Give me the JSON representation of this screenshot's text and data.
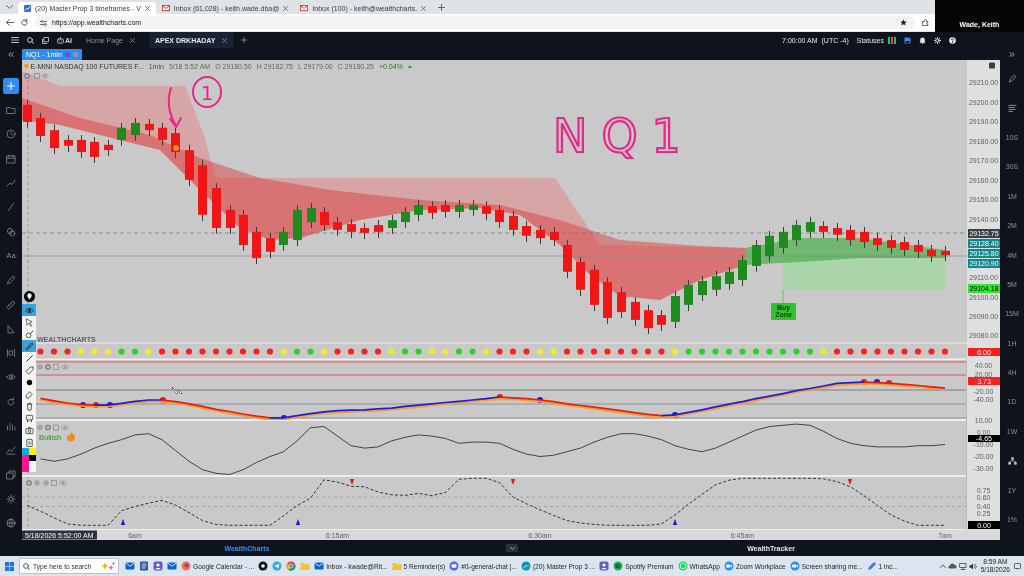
{
  "browser": {
    "tabs": [
      {
        "title": "(20) Master Prop 3 timeframes - V",
        "selected": true
      },
      {
        "title": "Inbox (61,028) - keith.wade.dba@",
        "selected": false
      },
      {
        "title": "Inbox (100) - keith@wealthcharts.",
        "selected": false
      }
    ],
    "url": "https://app.wealthcharts.com"
  },
  "video_tile": {
    "name": "Wade, Keith"
  },
  "app_header": {
    "ai_label": "AI",
    "tabs": [
      {
        "label": "Home Page",
        "selected": false
      },
      {
        "label": "APEX DRKHADAY",
        "selected": true
      }
    ],
    "clock": "7:00:00 AM",
    "timezone": "(UTC -4)",
    "statuses_label": "Statuses",
    "status_bars": [
      {
        "color": "#22c55e"
      },
      {
        "color": "#ef4444"
      },
      {
        "color": "#22c55e"
      }
    ]
  },
  "layout_tab": {
    "label": "NQ1 - 1min"
  },
  "left_toolbar": {
    "text_tool": "Aa"
  },
  "chart": {
    "symbol": "E-MINI NASDAQ 100 FUTURES F...",
    "interval": "1min",
    "bar_time": "5/18 5:52 AM",
    "ohlc": [
      "O 29180.50",
      "H 29182.75",
      "L 29179.00",
      "C 29180.25"
    ],
    "change": "+0.04%",
    "chart_data": {
      "type": "candlestick",
      "x": [
        5.8667,
        5.8833,
        5.9,
        5.9167,
        5.9333,
        5.95,
        5.9667,
        5.9833,
        6,
        6.0167,
        6.0333,
        6.05,
        6.0667,
        6.0833,
        6.1,
        6.1167,
        6.1333,
        6.15,
        6.1667,
        6.1833,
        6.2,
        6.2167,
        6.2333,
        6.25,
        6.2667,
        6.2833,
        6.3,
        6.3167,
        6.3333,
        6.35,
        6.3667,
        6.3833,
        6.4,
        6.4167,
        6.4333,
        6.45,
        6.4667,
        6.4833,
        6.5,
        6.5167,
        6.5333,
        6.55,
        6.5667,
        6.5833,
        6.6,
        6.6167,
        6.6333,
        6.65,
        6.6667,
        6.6833,
        6.7,
        6.7167,
        6.7333,
        6.75,
        6.7667,
        6.7833,
        6.8,
        6.8167,
        6.8333,
        6.85,
        6.8667,
        6.8833,
        6.9,
        6.9167,
        6.9333,
        6.95,
        6.9667,
        6.9833,
        7
      ],
      "ohlc": [
        [
          29198.75,
          29201.25,
          29187.0,
          29190.0
        ],
        [
          29192.0,
          29194.5,
          29179.75,
          29182.75
        ],
        [
          29185.75,
          29188.5,
          29173.5,
          29176.5
        ],
        [
          29180.75,
          29183.25,
          29174.5,
          29177.75
        ],
        [
          29180.75,
          29183.25,
          29171.5,
          29174.5
        ],
        [
          29179.75,
          29182.25,
          29169.0,
          29172.0
        ],
        [
          29178.25,
          29180.75,
          29172.5,
          29175.5
        ],
        [
          29180.75,
          29189.5,
          29177.75,
          29187.0
        ],
        [
          29183.25,
          29192.0,
          29180.25,
          29189.5
        ],
        [
          29189.0,
          29191.5,
          29182.75,
          29185.75
        ],
        [
          29187.0,
          29189.5,
          29177.75,
          29180.75
        ],
        [
          29184.25,
          29187.0,
          29171.5,
          29174.5
        ],
        [
          29175.5,
          29178.25,
          29157.0,
          29160.25
        ],
        [
          29167.75,
          29170.5,
          29139.0,
          29142.25
        ],
        [
          29156.0,
          29158.5,
          29132.5,
          29135.5
        ],
        [
          29144.75,
          29147.25,
          29132.5,
          29135.5
        ],
        [
          29142.25,
          29144.75,
          29123.75,
          29126.75
        ],
        [
          29133.5,
          29136.0,
          29117.0,
          29120.0
        ],
        [
          29130.25,
          29133.0,
          29120.0,
          29123.25
        ],
        [
          29126.75,
          29136.0,
          29123.75,
          29133.5
        ],
        [
          29129.25,
          29147.25,
          29126.25,
          29144.75
        ],
        [
          29138.5,
          29148.25,
          29135.5,
          29145.75
        ],
        [
          29143.75,
          29146.25,
          29134.0,
          29137.0
        ],
        [
          29138.5,
          29141.25,
          29131.5,
          29134.5
        ],
        [
          29137.5,
          29140.0,
          29130.25,
          29133.5
        ],
        [
          29135.5,
          29138.0,
          29129.75,
          29133.0
        ],
        [
          29137.0,
          29139.5,
          29130.25,
          29133.5
        ],
        [
          29135.5,
          29142.25,
          29132.5,
          29139.5
        ],
        [
          29138.5,
          29146.25,
          29135.5,
          29143.75
        ],
        [
          29142.25,
          29150.0,
          29139.0,
          29147.25
        ],
        [
          29146.75,
          29149.25,
          29140.0,
          29143.25
        ],
        [
          29147.25,
          29150.0,
          29140.75,
          29143.75
        ],
        [
          29143.75,
          29150.0,
          29140.75,
          29147.25
        ],
        [
          29144.75,
          29150.0,
          29141.75,
          29147.25
        ],
        [
          29146.75,
          29149.25,
          29139.5,
          29142.75
        ],
        [
          29144.75,
          29147.25,
          29135.5,
          29138.5
        ],
        [
          29141.75,
          29144.25,
          29131.5,
          29134.5
        ],
        [
          29136.5,
          29139.0,
          29128.25,
          29131.5
        ],
        [
          29134.5,
          29137.0,
          29127.25,
          29130.25
        ],
        [
          29133.5,
          29136.0,
          29126.25,
          29129.25
        ],
        [
          29126.75,
          29129.25,
          29109.75,
          29113.0
        ],
        [
          29118.0,
          29120.5,
          29100.5,
          29103.75
        ],
        [
          29114.0,
          29116.5,
          29092.75,
          29096.0
        ],
        [
          29107.75,
          29110.25,
          29086.25,
          29089.25
        ],
        [
          29102.5,
          29105.25,
          29089.25,
          29092.25
        ],
        [
          29097.5,
          29100.0,
          29085.25,
          29088.25
        ],
        [
          29093.25,
          29096.0,
          29081.0,
          29084.0
        ],
        [
          29090.75,
          29093.25,
          29082.5,
          29085.75
        ],
        [
          29087.25,
          29103.0,
          29084.0,
          29100.5
        ],
        [
          29096.0,
          29108.75,
          29092.75,
          29106.25
        ],
        [
          29101.0,
          29110.75,
          29098.0,
          29108.25
        ],
        [
          29103.75,
          29113.5,
          29100.5,
          29110.75
        ],
        [
          29106.75,
          29115.5,
          29103.75,
          29113.0
        ],
        [
          29108.75,
          29121.5,
          29105.75,
          29119.0
        ],
        [
          29116.0,
          29129.25,
          29113.0,
          29126.75
        ],
        [
          29121.0,
          29134.0,
          29118.0,
          29131.5
        ],
        [
          29125.25,
          29136.0,
          29122.25,
          29133.5
        ],
        [
          29129.25,
          29139.5,
          29126.25,
          29137.0
        ],
        [
          29133.5,
          29141.25,
          29130.25,
          29138.5
        ],
        [
          29136.5,
          29139.0,
          29130.25,
          29133.5
        ],
        [
          29135.5,
          29138.0,
          29128.75,
          29132.0
        ],
        [
          29134.5,
          29137.0,
          29126.25,
          29129.25
        ],
        [
          29133.5,
          29136.0,
          29125.25,
          29128.25
        ],
        [
          29130.25,
          29133.0,
          29123.75,
          29126.75
        ],
        [
          29129.25,
          29132.0,
          29122.25,
          29125.25
        ],
        [
          29128.25,
          29131.0,
          29121.0,
          29124.25
        ],
        [
          29126.75,
          29129.25,
          29120.0,
          29123.25
        ],
        [
          29124.25,
          29126.75,
          29118.0,
          29121.0
        ],
        [
          29123.75,
          29126.25,
          29118.5,
          29121.5
        ]
      ],
      "xlim": [
        5.8605,
        7.0272
      ],
      "ylim": [
        28980.3,
        29221.8
      ],
      "yticks": [
        {
          "value": 29210,
          "label": "29210.00"
        },
        {
          "value": 29200,
          "label": "29200.00"
        },
        {
          "value": 29190,
          "label": "29190.00"
        },
        {
          "value": 29180,
          "label": "29180.00"
        },
        {
          "value": 29170,
          "label": "29170.00"
        },
        {
          "value": 29160,
          "label": "29160.00"
        },
        {
          "value": 29150,
          "label": "29150.00"
        },
        {
          "value": 29140,
          "label": "29140.00"
        },
        {
          "value": 29110,
          "label": "29110.00"
        },
        {
          "value": 29100,
          "label": "29100.00"
        },
        {
          "value": 29090,
          "label": "29090.00"
        },
        {
          "value": 29080,
          "label": "29080.00"
        }
      ],
      "xticks": [
        {
          "value": 6,
          "label": "6am"
        },
        {
          "value": 6.25,
          "label": "6:15am"
        },
        {
          "value": 6.5,
          "label": "6:30am"
        },
        {
          "value": 6.75,
          "label": "6:45am"
        },
        {
          "value": 7,
          "label": "7am"
        }
      ]
    },
    "price_tags": [
      {
        "label": "29132.75",
        "color": "#3c4048"
      },
      {
        "label": "29128.40",
        "color": "#13878c"
      },
      {
        "label": "29125.80",
        "color": "#13878c"
      },
      {
        "label": "29120.90",
        "color": "#13878c"
      },
      {
        "label": "29104.18",
        "color": "#2ee82e"
      }
    ],
    "buy_zone": "Buy Zone",
    "annotations": [
      {
        "kind": "circled_number",
        "text": "1"
      },
      {
        "kind": "handwriting",
        "text": "NQ1"
      }
    ]
  },
  "indicators": [
    {
      "kind": "dots",
      "watermark": "WEALTHCHARTS",
      "dots": [
        {
          "color": "#ff1f1f"
        },
        {
          "color": "#ff1f1f"
        },
        {
          "color": "#ff1f1f"
        },
        {
          "color": "#f2ee1a"
        },
        {
          "color": "#f2ee1a"
        },
        {
          "color": "#f2ee1a"
        },
        {
          "color": "#1fd81f"
        },
        {
          "color": "#1fd81f"
        },
        {
          "color": "#f2ee1a"
        },
        {
          "color": "#ff1f1f"
        },
        {
          "color": "#ff1f1f"
        },
        {
          "color": "#ff1f1f"
        },
        {
          "color": "#ff1f1f"
        },
        {
          "color": "#ff1f1f"
        },
        {
          "color": "#ff1f1f"
        },
        {
          "color": "#ff1f1f"
        },
        {
          "color": "#ff1f1f"
        },
        {
          "color": "#ff1f1f"
        },
        {
          "color": "#f2ee1a"
        },
        {
          "color": "#1fd81f"
        },
        {
          "color": "#1fd81f"
        },
        {
          "color": "#f2ee1a"
        },
        {
          "color": "#ff1f1f"
        },
        {
          "color": "#ff1f1f"
        },
        {
          "color": "#ff1f1f"
        },
        {
          "color": "#ff1f1f"
        },
        {
          "color": "#f2ee1a"
        },
        {
          "color": "#1fd81f"
        },
        {
          "color": "#1fd81f"
        },
        {
          "color": "#f2ee1a"
        },
        {
          "color": "#f2ee1a"
        },
        {
          "color": "#1fd81f"
        },
        {
          "color": "#1fd81f"
        },
        {
          "color": "#f2ee1a"
        },
        {
          "color": "#ff1f1f"
        },
        {
          "color": "#ff1f1f"
        },
        {
          "color": "#ff1f1f"
        },
        {
          "color": "#f2ee1a"
        },
        {
          "color": "#f2ee1a"
        },
        {
          "color": "#ff1f1f"
        },
        {
          "color": "#ff1f1f"
        },
        {
          "color": "#ff1f1f"
        },
        {
          "color": "#ff1f1f"
        },
        {
          "color": "#ff1f1f"
        },
        {
          "color": "#ff1f1f"
        },
        {
          "color": "#ff1f1f"
        },
        {
          "color": "#ff1f1f"
        },
        {
          "color": "#f2ee1a"
        },
        {
          "color": "#1fd81f"
        },
        {
          "color": "#1fd81f"
        },
        {
          "color": "#1fd81f"
        },
        {
          "color": "#1fd81f"
        },
        {
          "color": "#1fd81f"
        },
        {
          "color": "#1fd81f"
        },
        {
          "color": "#1fd81f"
        },
        {
          "color": "#1fd81f"
        },
        {
          "color": "#1fd81f"
        },
        {
          "color": "#1fd81f"
        },
        {
          "color": "#f2ee1a"
        },
        {
          "color": "#ff1f1f"
        },
        {
          "color": "#ff1f1f"
        },
        {
          "color": "#ff1f1f"
        },
        {
          "color": "#ff1f1f"
        },
        {
          "color": "#ff1f1f"
        },
        {
          "color": "#ff1f1f"
        },
        {
          "color": "#ff1f1f"
        },
        {
          "color": "#ff1f1f"
        },
        {
          "color": "#ff1f1f"
        }
      ],
      "value_tag": {
        "text": "0.00",
        "color": "#ff1f1f"
      }
    },
    {
      "kind": "oscillator",
      "value_tag": {
        "text": "3.73",
        "color": "#ff1f1f"
      },
      "chart_data": {
        "type": "line",
        "categories": [
          null,
          null,
          null,
          null,
          null,
          null,
          null,
          null,
          null,
          null,
          null,
          null,
          null,
          null,
          null,
          null,
          null,
          null,
          null,
          null,
          null,
          null,
          null,
          null,
          null,
          null,
          null,
          null,
          null,
          null,
          null,
          null,
          null,
          null,
          null,
          null,
          null,
          null,
          null,
          null,
          null,
          null,
          null,
          null,
          null,
          null,
          null,
          null,
          null,
          null,
          null,
          null,
          null,
          null,
          null,
          null,
          null,
          null,
          null,
          null,
          null,
          null,
          null,
          null,
          null,
          null,
          null,
          null,
          null
        ],
        "series": [
          {
            "color": "#f5a030",
            "values": [
              null,
              -39,
              -45,
              -50,
              -54,
              -55,
              -55,
              -51,
              -46,
              -43,
              -43,
              -47,
              -52,
              -59,
              -65,
              -71,
              -76,
              -81,
              -86,
              -86,
              -80,
              -75,
              -71,
              -69,
              -67,
              -66,
              -65,
              -62,
              -59,
              -56,
              -52,
              -49,
              -46,
              -43,
              -40,
              -37,
              -38,
              -40,
              -43,
              -48,
              -52,
              -56,
              -60,
              -65,
              -69,
              -73,
              -77,
              -81,
              -79,
              -72,
              -66,
              -60,
              -53,
              -47,
              -41,
              -34,
              -28,
              -21,
              -16,
              -10,
              -5,
              -3,
              -1,
              -2,
              -4,
              -7,
              -9,
              -12,
              -15
            ]
          },
          {
            "color": "#e81c1c",
            "values": [
              null,
              -36,
              -42,
              -47,
              -51,
              -52,
              null,
              null,
              null,
              null,
              -40,
              -44,
              -49,
              -55,
              -62,
              -67,
              -73,
              -78,
              -82,
              null,
              null,
              null,
              null,
              null,
              null,
              null,
              null,
              null,
              null,
              null,
              null,
              null,
              null,
              null,
              null,
              -33,
              -35,
              -37,
              -40,
              -44,
              -49,
              -53,
              -57,
              -61,
              -65,
              -70,
              -74,
              -77,
              null,
              null,
              null,
              null,
              null,
              null,
              null,
              null,
              null,
              null,
              null,
              null,
              null,
              null,
              2,
              1,
              -1,
              -3,
              -6,
              -9,
              -12
            ]
          },
          {
            "color": "#1d1de0",
            "values": [
              null,
              null,
              null,
              null,
              null,
              -52,
              -52,
              -48,
              -43,
              -40,
              -40,
              null,
              null,
              null,
              null,
              null,
              null,
              null,
              -82,
              -82,
              -77,
              -72,
              -68,
              -65,
              -64,
              -63,
              -61,
              -59,
              -55,
              -52,
              -49,
              -46,
              -43,
              -40,
              -37,
              -33,
              null,
              null,
              null,
              null,
              null,
              null,
              null,
              null,
              null,
              null,
              null,
              -77,
              -75,
              -69,
              -63,
              -56,
              -50,
              -44,
              -37,
              -31,
              -25,
              -18,
              -13,
              -7,
              -1,
              1,
              2,
              null,
              null,
              null,
              null,
              null,
              null
            ]
          }
        ],
        "ylim": [
          -87.06,
          56.47
        ],
        "yticks": [
          {
            "value": 40,
            "label": "40.00"
          },
          {
            "value": 20,
            "label": "20.00"
          },
          {
            "value": -20,
            "label": "-20.00"
          },
          {
            "value": -40,
            "label": "-40.00"
          }
        ]
      }
    },
    {
      "kind": "momentum",
      "signal": "Bullish",
      "value_tag": {
        "text": "-4.65",
        "color": "#000000"
      },
      "chart_data": {
        "type": "line",
        "categories": [
          null,
          null,
          null,
          null,
          null,
          null,
          null,
          null,
          null,
          null,
          null,
          null,
          null,
          null,
          null,
          null,
          null,
          null,
          null,
          null,
          null,
          null,
          null,
          null,
          null,
          null,
          null,
          null,
          null,
          null,
          null,
          null,
          null,
          null,
          null,
          null,
          null,
          null,
          null,
          null,
          null,
          null,
          null,
          null,
          null,
          null,
          null,
          null,
          null,
          null,
          null,
          null,
          null,
          null,
          null,
          null,
          null,
          null,
          null,
          null,
          null,
          null,
          null,
          null,
          null,
          null,
          null,
          null,
          null
        ],
        "series": [
          {
            "color": "#333333",
            "values": [
              null,
              -22,
              -24,
              -22,
              -18,
              -13,
              -9,
              -6,
              -2,
              -1,
              -6,
              -15,
              -24,
              -31,
              -34,
              -35,
              -31,
              -25,
              -20,
              -16,
              -7,
              4,
              5,
              -3,
              -11,
              -13,
              -12,
              -7,
              -4,
              -2,
              -3,
              -5,
              -9,
              -8,
              -8,
              -9,
              -14,
              -18,
              -20,
              -19,
              -16,
              -13,
              -8,
              -4,
              -1,
              -1,
              -3,
              -6,
              -11,
              -14,
              -16,
              -13,
              -8,
              -3,
              2,
              5,
              6,
              7,
              6,
              1,
              -5,
              -9,
              -11,
              -12,
              -12,
              -12,
              -11,
              -11,
              -10
            ]
          }
        ],
        "ylim": [
          -36.25,
          10.42
        ],
        "yticks": [
          {
            "value": 10,
            "label": "10.00"
          },
          {
            "value": 0,
            "label": "0.00"
          },
          {
            "value": -10,
            "label": "-10.00"
          },
          {
            "value": -20,
            "label": "-20.00"
          },
          {
            "value": -30,
            "label": "-30.00"
          }
        ]
      }
    },
    {
      "kind": "probability",
      "value_tag": {
        "text": "0.00",
        "color": "#000000"
      },
      "chart_data": {
        "type": "line",
        "categories": [
          null,
          null,
          null,
          null,
          null,
          null,
          null,
          null,
          null,
          null,
          null,
          null,
          null,
          null,
          null,
          null,
          null,
          null,
          null,
          null,
          null,
          null,
          null,
          null,
          null,
          null,
          null,
          null,
          null,
          null,
          null,
          null,
          null,
          null,
          null,
          null,
          null,
          null,
          null,
          null,
          null,
          null,
          null,
          null,
          null,
          null,
          null,
          null,
          null,
          null,
          null,
          null,
          null,
          null,
          null,
          null,
          null,
          null,
          null,
          null,
          null,
          null,
          null,
          null,
          null,
          null,
          null,
          null,
          null
        ],
        "series": [
          {
            "color": "#222222",
            "line_style": "dashed",
            "values": [
              0.43,
              0.3,
              0.16,
              0.03,
              0.0,
              0.0,
              0.0,
              0.31,
              0.4,
              0.47,
              0.53,
              0.43,
              0.27,
              0.1,
              0.02,
              0.0,
              0.0,
              0.0,
              0.0,
              0.2,
              0.42,
              0.58,
              0.97,
              0.92,
              0.83,
              0.82,
              0.71,
              0.65,
              0.64,
              0.68,
              0.63,
              0.7,
              0.98,
              1.0,
              1.0,
              0.91,
              0.6,
              0.46,
              0.33,
              0.21,
              0.1,
              0.05,
              0.02,
              0.0,
              0.0,
              0.0,
              0.0,
              0.03,
              0.22,
              0.45,
              0.66,
              0.86,
              0.96,
              1.0,
              1.0,
              1.0,
              1.0,
              1.0,
              1.0,
              0.99,
              0.93,
              0.82,
              0.63,
              0.42,
              0.22,
              0.09,
              0.0,
              0.0,
              0.0
            ]
          }
        ],
        "ylim": [
          -0.1,
          1.05
        ],
        "yticks": [
          {
            "value": 0.75,
            "label": "0.75"
          },
          {
            "value": 0.6,
            "label": "0.60"
          },
          {
            "value": 0.4,
            "label": "0.40"
          },
          {
            "value": 0.25,
            "label": "0.25"
          }
        ]
      }
    }
  ],
  "time_axis": {
    "cursor_time": "5/18/2026 5:52:00 AM"
  },
  "drawing_toolbar": {
    "tools": [
      {
        "selected": true
      },
      {
        "selected": false
      },
      {
        "selected": false
      },
      {
        "selected": true
      },
      {
        "selected": false
      },
      {
        "selected": false
      },
      {
        "selected": false
      },
      {
        "selected": false
      },
      {
        "selected": false
      },
      {
        "selected": false
      },
      {
        "selected": false
      },
      {
        "selected": false
      }
    ],
    "palette": [
      {
        "color": "#19a7e0"
      },
      {
        "color": "#ffef00"
      },
      {
        "color": "#ff1493"
      },
      {
        "color": "#000000"
      }
    ]
  },
  "right_toolbar": {
    "timeframes": [
      "10S",
      "30S",
      "1M",
      "2M",
      "4M",
      "5M",
      "15M",
      "1H",
      "4H",
      "1D",
      "1W"
    ],
    "extra": [
      "1Y",
      "1%"
    ]
  },
  "bottom_panel": {
    "tabs": [
      {
        "label": "WealthCharts",
        "selected": true
      },
      {
        "label": "WealthTracker",
        "selected": false
      }
    ]
  },
  "taskbar": {
    "search_placeholder": "Type here to search",
    "windows": [
      {
        "label": "Google Calendar - ..."
      },
      {
        "label": "Inbox - kwade@Rit..."
      },
      {
        "label": "5 Reminder(s)"
      },
      {
        "label": "#ß-general-chat |..."
      },
      {
        "label": "(20) Master Prop 3 ..."
      },
      {
        "label": "Spotify Premium"
      },
      {
        "label": "WhatsApp"
      },
      {
        "label": "Zoom Workplace"
      },
      {
        "label": "Screen sharing me..."
      },
      {
        "label": "1 inc..."
      }
    ],
    "time": "8:59 AM",
    "date": "5/18/2026"
  }
}
